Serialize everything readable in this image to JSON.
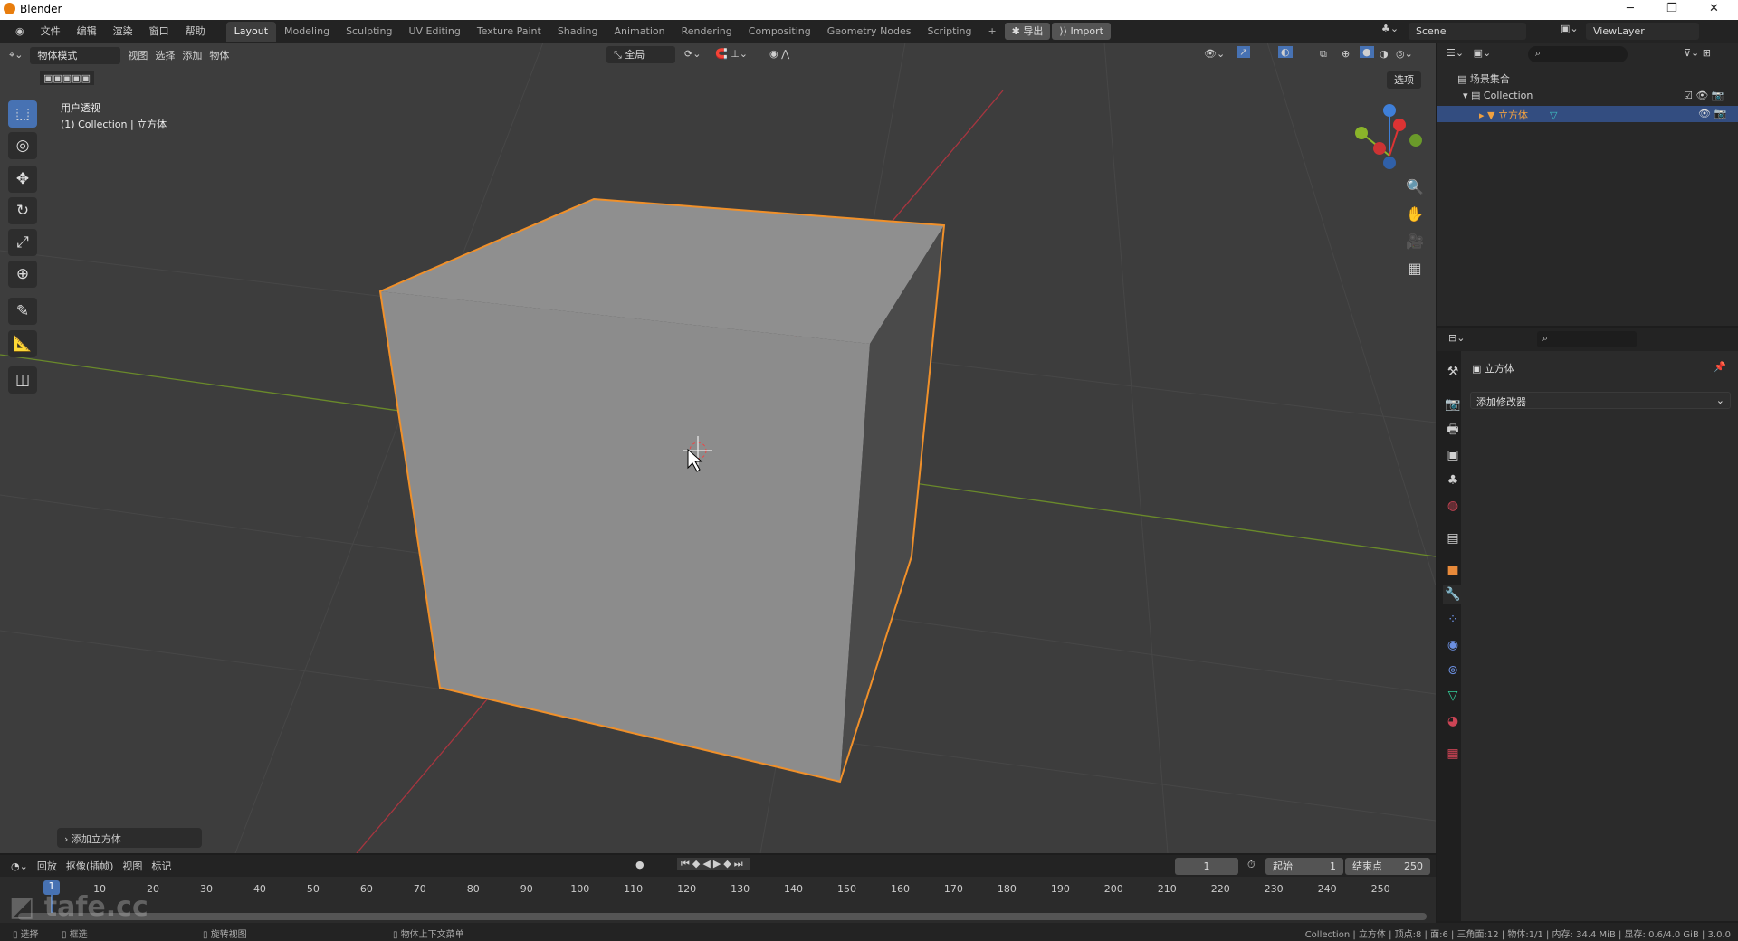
{
  "titlebar": {
    "title": "Blender",
    "minimize": "─",
    "maximize": "❐",
    "close": "✕"
  },
  "menu": [
    "文件",
    "编辑",
    "渲染",
    "窗口",
    "帮助"
  ],
  "workspaces": [
    "Layout",
    "Modeling",
    "Sculpting",
    "UV Editing",
    "Texture Paint",
    "Shading",
    "Animation",
    "Rendering",
    "Compositing",
    "Geometry Nodes",
    "Scripting"
  ],
  "workspace_add": "+",
  "export_label": "导出",
  "import_label": "Import",
  "scene": "Scene",
  "view_layer": "ViewLayer",
  "viewport": {
    "mode": "物体模式",
    "menus": [
      "视图",
      "选择",
      "添加",
      "物体"
    ],
    "transform_orientation": "全局",
    "options": "选项",
    "view_name": "用户透视",
    "collection_info": "(1) Collection | 立方体",
    "last_op": "添加立方体",
    "colors": {
      "bg": "#3d3d3d",
      "cube": "#8e8e8e",
      "selection": "#f0902a",
      "x_axis": "#a8353f",
      "y_axis": "#6a8a2a"
    }
  },
  "outliner": {
    "scene_collection": "场景集合",
    "collection": "Collection",
    "object": "立方体"
  },
  "properties": {
    "object_name": "立方体",
    "add_modifier": "添加修改器"
  },
  "timeline": {
    "menus": [
      "回放",
      "抠像(插帧)",
      "视图",
      "标记"
    ],
    "current_frame": "1",
    "start_label": "起始",
    "start": "1",
    "end_label": "结束点",
    "end": "250",
    "ticks": [
      "10",
      "20",
      "30",
      "40",
      "50",
      "60",
      "70",
      "80",
      "90",
      "100",
      "110",
      "120",
      "130",
      "140",
      "150",
      "160",
      "170",
      "180",
      "190",
      "200",
      "210",
      "220",
      "230",
      "240",
      "250"
    ],
    "playhead": "1"
  },
  "status": {
    "select": "选择",
    "box_select": "框选",
    "rotate_view": "旋转视图",
    "context_menu": "物体上下文菜单",
    "info": "Collection | 立方体 | 顶点:8 | 面:6 | 三角面:12 | 物体:1/1 | 内存: 34.4 MiB | 显存: 0.6/4.0 GiB | 3.0.0"
  },
  "watermark": "tafe.cc"
}
